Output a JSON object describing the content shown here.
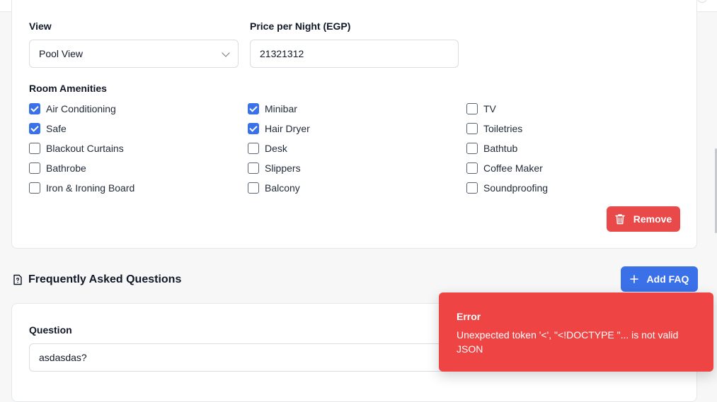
{
  "room": {
    "view_label": "View",
    "view_value": "Pool View",
    "price_label": "Price per Night (EGP)",
    "price_value": "21321312",
    "amenities_label": "Room Amenities",
    "amenities": [
      {
        "label": "Air Conditioning",
        "checked": true
      },
      {
        "label": "Minibar",
        "checked": true
      },
      {
        "label": "TV",
        "checked": false
      },
      {
        "label": "Safe",
        "checked": true
      },
      {
        "label": "Hair Dryer",
        "checked": true
      },
      {
        "label": "Toiletries",
        "checked": false
      },
      {
        "label": "Blackout Curtains",
        "checked": false
      },
      {
        "label": "Desk",
        "checked": false
      },
      {
        "label": "Bathtub",
        "checked": false
      },
      {
        "label": "Bathrobe",
        "checked": false
      },
      {
        "label": "Slippers",
        "checked": false
      },
      {
        "label": "Coffee Maker",
        "checked": false
      },
      {
        "label": "Iron & Ironing Board",
        "checked": false
      },
      {
        "label": "Balcony",
        "checked": false
      },
      {
        "label": "Soundproofing",
        "checked": false
      }
    ],
    "remove_label": "Remove"
  },
  "faq": {
    "title": "Frequently Asked Questions",
    "add_label": "Add FAQ",
    "question_label": "Question",
    "question_value": "asdasdas?"
  },
  "toast": {
    "title": "Error",
    "message": "Unexpected token '<', \"<!DOCTYPE \"... is not valid JSON"
  },
  "colors": {
    "accent": "#3b71e8",
    "danger": "#e94948",
    "toast_bg": "#ef4444"
  }
}
